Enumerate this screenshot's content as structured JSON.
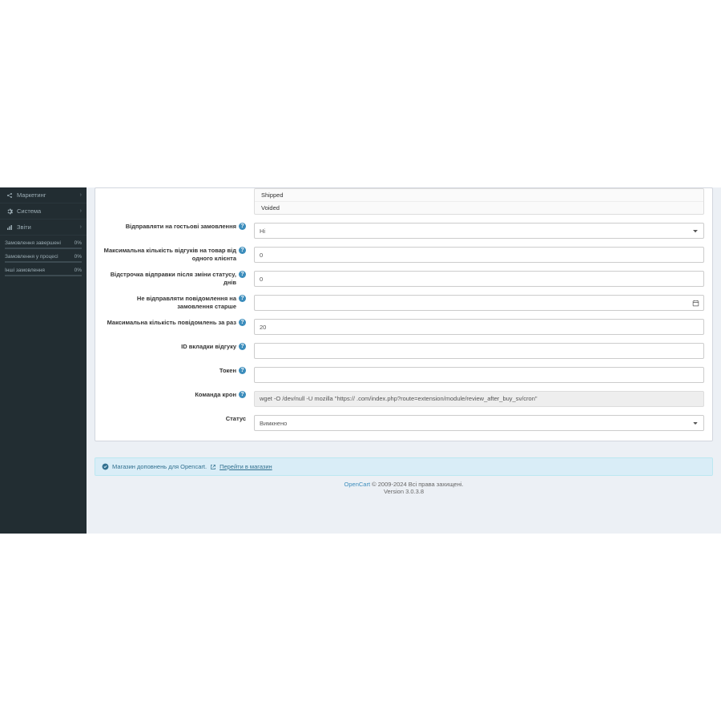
{
  "sidebar": {
    "items": [
      {
        "label": "Маркетинг"
      },
      {
        "label": "Система"
      },
      {
        "label": "Звіти"
      }
    ],
    "stats": [
      {
        "label": "Замовлення завершені",
        "value": "0%"
      },
      {
        "label": "Замовлення у процесі",
        "value": "0%"
      },
      {
        "label": "Інші замовлення",
        "value": "0%"
      }
    ]
  },
  "form": {
    "status_options": [
      "Shipped",
      "Voided"
    ],
    "guest_orders": {
      "label": "Відправляти на гостьові замовлення",
      "value": "Ні"
    },
    "max_reviews": {
      "label": "Максимальна кількість відгуків на товар від одного клієнта",
      "value": "0"
    },
    "delay": {
      "label": "Відстрочка відправки після зміни статусу, днів",
      "value": "0"
    },
    "older_than": {
      "label": "Не відправляти повідомлення на замовлення старше",
      "value": ""
    },
    "max_messages": {
      "label": "Максимальна кількість повідомлень за раз",
      "value": "20"
    },
    "tab_id": {
      "label": "ID вкладки відгуку",
      "value": ""
    },
    "token": {
      "label": "Токен",
      "value": ""
    },
    "cron": {
      "label": "Команда крон",
      "value": "wget -O /dev/null -U mozilla \"https://             .com/index.php?route=extension/module/review_after_buy_sv/cron\""
    },
    "status": {
      "label": "Статус",
      "value": "Вимкнено"
    }
  },
  "alert": {
    "text": "Магазин доповнень для Opencart.",
    "link": "Перейти в магазин"
  },
  "footer": {
    "brand": "OpenCart",
    "rights": " © 2009-2024 Всі права захищені.",
    "version": "Version 3.0.3.8"
  }
}
